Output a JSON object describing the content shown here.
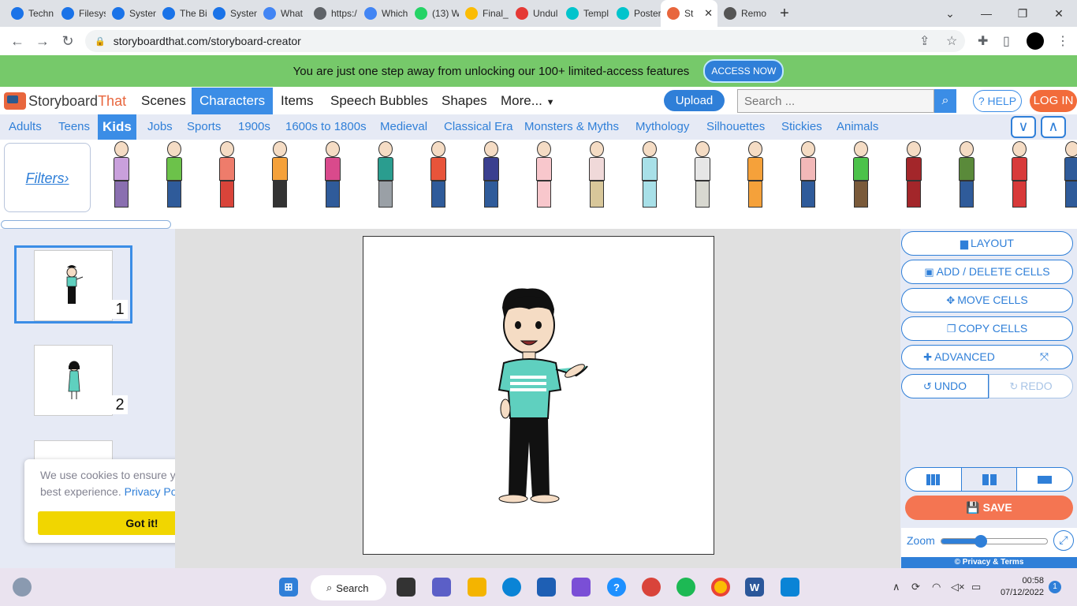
{
  "browser": {
    "tabs": [
      {
        "label": "Techn",
        "color": "#1a73e8"
      },
      {
        "label": "Filesys",
        "color": "#1a73e8"
      },
      {
        "label": "Systen",
        "color": "#1a73e8"
      },
      {
        "label": "The Bi",
        "color": "#1a73e8"
      },
      {
        "label": "Systen",
        "color": "#1a73e8"
      },
      {
        "label": "What",
        "color": "#4285f4"
      },
      {
        "label": "https:/",
        "color": "#5f6368"
      },
      {
        "label": "Which",
        "color": "#4285f4"
      },
      {
        "label": "(13) W",
        "color": "#25d366"
      },
      {
        "label": "Final_",
        "color": "#fbbc04"
      },
      {
        "label": "Undul",
        "color": "#e53935"
      },
      {
        "label": "Templ",
        "color": "#00c4cc"
      },
      {
        "label": "Poster",
        "color": "#00c4cc"
      },
      {
        "label": "St",
        "color": "#e8663d"
      },
      {
        "label": "Remo",
        "color": "#555555"
      }
    ],
    "url": "storyboardthat.com/storyboard-creator"
  },
  "promo": {
    "text": "You are just one step away from unlocking our 100+ limited-access features",
    "button": "ACCESS NOW"
  },
  "nav": {
    "logo_part1": "Storyboard",
    "logo_part2": "That",
    "items": [
      "Scenes",
      "Characters",
      "Items",
      "Speech Bubbles",
      "Shapes",
      "More..."
    ],
    "upload": "Upload",
    "search_placeholder": "Search ...",
    "help": "? HELP",
    "login": "LOG IN"
  },
  "categories": [
    "Adults",
    "Teens",
    "Kids",
    "Jobs",
    "Sports",
    "1900s",
    "1600s to 1800s",
    "Medieval",
    "Classical Era",
    "Monsters & Myths",
    "Mythology",
    "Silhouettes",
    "Stickies",
    "Animals"
  ],
  "filters_label": "Filters›",
  "characters": [
    {
      "top": "#c9a0dc",
      "legs": "#8a6fb0"
    },
    {
      "top": "#6cc24a",
      "legs": "#2f5b9a"
    },
    {
      "top": "#ee7c6b",
      "legs": "#d9443a"
    },
    {
      "top": "#f5a13a",
      "legs": "#333333"
    },
    {
      "top": "#d94a8c",
      "legs": "#2f5b9a"
    },
    {
      "top": "#2a9d8f",
      "legs": "#9aa0a6"
    },
    {
      "top": "#e8543a",
      "legs": "#2f5b9a"
    },
    {
      "top": "#3a3f8f",
      "legs": "#2f5b9a"
    },
    {
      "top": "#f8c7cc",
      "legs": "#f8c7cc"
    },
    {
      "top": "#f0d9d9",
      "legs": "#d8c79a"
    },
    {
      "top": "#a8e0e8",
      "legs": "#a8e0e8"
    },
    {
      "top": "#e6e6e6",
      "legs": "#d8d8d0"
    },
    {
      "top": "#f5a13a",
      "legs": "#f5a13a"
    },
    {
      "top": "#f2b8b8",
      "legs": "#2f5b9a"
    },
    {
      "top": "#4cc24a",
      "legs": "#7a5a3a"
    },
    {
      "top": "#a3262a",
      "legs": "#a3262a"
    },
    {
      "top": "#5a8a3a",
      "legs": "#2f5b9a"
    },
    {
      "top": "#d83a3a",
      "legs": "#d83a3a"
    },
    {
      "top": "#2f5b9a",
      "legs": "#2f5b9a"
    }
  ],
  "cells": [
    {
      "number": "1"
    },
    {
      "number": "2"
    }
  ],
  "cookie": {
    "text": "We use cookies to ensure you get the best experience.",
    "link": "Privacy Policy",
    "button": "Got it!"
  },
  "actions": {
    "layout": "LAYOUT",
    "add_delete": "ADD / DELETE CELLS",
    "move": "MOVE CELLS",
    "copy": "COPY CELLS",
    "advanced": "ADVANCED",
    "undo": "UNDO",
    "redo": "REDO",
    "save": "SAVE",
    "zoom": "Zoom",
    "zoom_level": 0.37,
    "privacy": "© Privacy & Terms"
  },
  "taskbar": {
    "search": "Search",
    "time": "00:58",
    "date": "07/12/2022",
    "notifications": "1"
  },
  "colors": {
    "accent": "#3b8de6",
    "promo_bg": "#76c96a",
    "save": "#f47552",
    "login": "#f26b3a"
  }
}
